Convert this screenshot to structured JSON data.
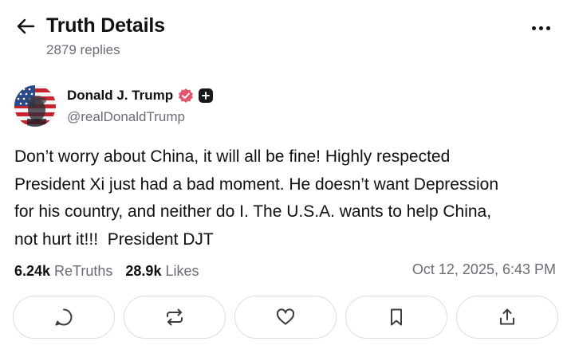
{
  "header": {
    "back_icon": "arrow-left-icon",
    "title": "Truth Details",
    "replies": "2879 replies",
    "more_icon": "more-horizontal-icon"
  },
  "post": {
    "author": {
      "name": "Donald J. Trump",
      "handle": "@realDonaldTrump",
      "verified_icon": "verified-badge-icon",
      "verified_color": "#e4566d",
      "plus_icon": "plus-badge-icon"
    },
    "text": "Don’t worry about China, it will all be fine! Highly respected\nPresident Xi just had a bad moment. He doesn’t want Depression\nfor his country, and neither do I. The U.S.A. wants to help China,\nnot hurt it!!!  President DJT",
    "stats": {
      "retruths_count": "6.24k",
      "retruths_label": "ReTruths",
      "likes_count": "28.9k",
      "likes_label": "Likes"
    },
    "timestamp": "Oct 12, 2025, 6:43 PM"
  },
  "actions": [
    {
      "icon": "reply-icon"
    },
    {
      "icon": "retruth-icon"
    },
    {
      "icon": "heart-icon"
    },
    {
      "icon": "bookmark-icon"
    },
    {
      "icon": "share-icon"
    }
  ]
}
